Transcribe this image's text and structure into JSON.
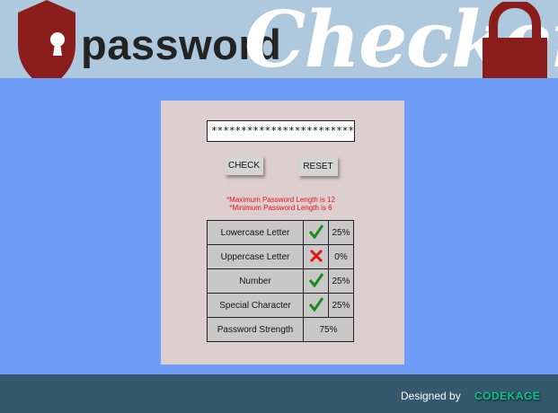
{
  "header": {
    "title_part1": "password",
    "title_part2": "Checker"
  },
  "form": {
    "password_value": "************************",
    "check_label": "CHECK",
    "reset_label": "RESET",
    "note_max": "*Maximum Password Length is 12",
    "note_min": "*Minimum Password Length is 6"
  },
  "results": {
    "rows": [
      {
        "label": "Lowercase Letter",
        "status": "check-icon",
        "percent": "25%"
      },
      {
        "label": "Uppercase Letter",
        "status": "cross-icon",
        "percent": "0%"
      },
      {
        "label": "Number",
        "status": "check-icon",
        "percent": "25%"
      },
      {
        "label": "Special Character",
        "status": "check-icon",
        "percent": "25%"
      }
    ],
    "strength_label": "Password Strength",
    "strength_value": "75%"
  },
  "footer": {
    "designed_by": "Designed by",
    "brand": "CODEKAGE"
  },
  "colors": {
    "header_bg": "#aec9dd",
    "body_bg": "#6f9cf7",
    "panel_bg": "#ddcfcf",
    "accent_red": "#8b1c1c",
    "check_green": "#1e8a1e",
    "cross_red": "#e01515",
    "footer_bg": "#35586c",
    "brand_green": "#00c88c"
  }
}
